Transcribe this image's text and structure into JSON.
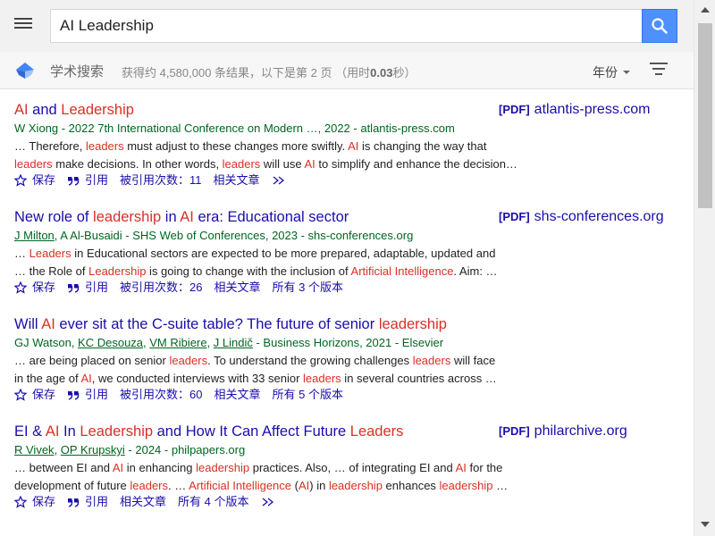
{
  "search": {
    "query": "AI Leadership",
    "button_icon": "search-icon",
    "button_color": "#4d90fe"
  },
  "header": {
    "menu_icon": "hamburger-menu-icon",
    "brand": "学术搜索",
    "stats_prefix": "获得约 4,580,000 条结果，以下是第 2 页 （用时",
    "stats_time": "0.03",
    "stats_suffix": "秒）",
    "year_label": "年份",
    "filter_icon": "filter-icon"
  },
  "colors": {
    "link": "#1a0dab",
    "highlight": "#d93025",
    "meta": "#006621"
  },
  "actions_labels": {
    "save": "保存",
    "cite": "引用",
    "related": "相关文章"
  },
  "results": [
    {
      "title": [
        {
          "t": "AI",
          "h": true
        },
        {
          "t": " and ",
          "h": false
        },
        {
          "t": "Leadership",
          "h": true
        }
      ],
      "meta": [
        {
          "t": "W Xiong - 2022 7th International Conference on Modern …, 2022 - atlantis-press.com",
          "u": false
        }
      ],
      "snippet": [
        [
          {
            "t": "… Therefore, ",
            "h": false
          },
          {
            "t": "leaders",
            "h": true
          },
          {
            "t": " must adjust to these changes more swiftly. ",
            "h": false
          },
          {
            "t": "AI",
            "h": true
          },
          {
            "t": " is changing the way that",
            "h": false
          }
        ],
        [
          {
            "t": "leaders",
            "h": true
          },
          {
            "t": " make decisions. In other words, ",
            "h": false
          },
          {
            "t": "leaders",
            "h": true
          },
          {
            "t": " will use ",
            "h": false
          },
          {
            "t": "AI",
            "h": true
          },
          {
            "t": " to simplify and enhance the decision…",
            "h": false
          }
        ]
      ],
      "cited": "被引用次数：11",
      "versions": "",
      "more": true,
      "pdf_tag": "[PDF]",
      "pdf_site": "atlantis-press.com"
    },
    {
      "title": [
        {
          "t": "New role of ",
          "h": false
        },
        {
          "t": "leadership",
          "h": true
        },
        {
          "t": " in ",
          "h": false
        },
        {
          "t": "AI",
          "h": true
        },
        {
          "t": " era: Educational sector",
          "h": false
        }
      ],
      "meta": [
        {
          "t": "J Milton",
          "u": true
        },
        {
          "t": ", A Al-Busaidi - SHS Web of Conferences, 2023 - shs-conferences.org",
          "u": false
        }
      ],
      "snippet": [
        [
          {
            "t": "… ",
            "h": false
          },
          {
            "t": "Leaders",
            "h": true
          },
          {
            "t": " in Educational sectors are expected to be more prepared, adaptable, updated and",
            "h": false
          }
        ],
        [
          {
            "t": "… the Role of ",
            "h": false
          },
          {
            "t": "Leadership",
            "h": true
          },
          {
            "t": " is going to change with the inclusion of ",
            "h": false
          },
          {
            "t": "Artificial Intelligence",
            "h": true
          },
          {
            "t": ". Aim: …",
            "h": false
          }
        ]
      ],
      "cited": "被引用次数：26",
      "versions": "所有 3 个版本",
      "more": false,
      "pdf_tag": "[PDF]",
      "pdf_site": "shs-conferences.org"
    },
    {
      "title": [
        {
          "t": "Will ",
          "h": false
        },
        {
          "t": "AI",
          "h": true
        },
        {
          "t": " ever sit at the C-suite table? The future of senior ",
          "h": false
        },
        {
          "t": "leadership",
          "h": true
        }
      ],
      "meta": [
        {
          "t": "GJ Watson, ",
          "u": false
        },
        {
          "t": "KC Desouza",
          "u": true
        },
        {
          "t": ", ",
          "u": false
        },
        {
          "t": "VM Ribiere",
          "u": true
        },
        {
          "t": ", ",
          "u": false
        },
        {
          "t": "J Lindič",
          "u": true
        },
        {
          "t": " - Business Horizons, 2021 - Elsevier",
          "u": false
        }
      ],
      "snippet": [
        [
          {
            "t": "… are being placed on senior ",
            "h": false
          },
          {
            "t": "leaders",
            "h": true
          },
          {
            "t": ". To understand the growing challenges ",
            "h": false
          },
          {
            "t": "leaders",
            "h": true
          },
          {
            "t": " will face",
            "h": false
          }
        ],
        [
          {
            "t": "in the age of ",
            "h": false
          },
          {
            "t": "AI",
            "h": true
          },
          {
            "t": ", we conducted interviews with 33 senior ",
            "h": false
          },
          {
            "t": "leaders",
            "h": true
          },
          {
            "t": " in several countries across …",
            "h": false
          }
        ]
      ],
      "cited": "被引用次数：60",
      "versions": "所有 5 个版本",
      "more": false,
      "pdf_tag": "",
      "pdf_site": ""
    },
    {
      "title": [
        {
          "t": "EI & ",
          "h": false
        },
        {
          "t": "AI",
          "h": true
        },
        {
          "t": " In ",
          "h": false
        },
        {
          "t": "Leadership",
          "h": true
        },
        {
          "t": " and How It Can Affect Future ",
          "h": false
        },
        {
          "t": "Leaders",
          "h": true
        }
      ],
      "meta": [
        {
          "t": "R Vivek",
          "u": true
        },
        {
          "t": ", ",
          "u": false
        },
        {
          "t": "OP Krupskyi",
          "u": true
        },
        {
          "t": " - 2024 - philpapers.org",
          "u": false
        }
      ],
      "snippet": [
        [
          {
            "t": "… between EI and ",
            "h": false
          },
          {
            "t": "AI",
            "h": true
          },
          {
            "t": " in enhancing ",
            "h": false
          },
          {
            "t": "leadership",
            "h": true
          },
          {
            "t": " practices. Also, … of integrating EI and ",
            "h": false
          },
          {
            "t": "AI",
            "h": true
          },
          {
            "t": " for the",
            "h": false
          }
        ],
        [
          {
            "t": "development of future ",
            "h": false
          },
          {
            "t": "leaders",
            "h": true
          },
          {
            "t": ". … ",
            "h": false
          },
          {
            "t": "Artificial Intelligence",
            "h": true
          },
          {
            "t": " (",
            "h": false
          },
          {
            "t": "AI",
            "h": true
          },
          {
            "t": ") in ",
            "h": false
          },
          {
            "t": "leadership",
            "h": true
          },
          {
            "t": " enhances ",
            "h": false
          },
          {
            "t": "leadership",
            "h": true
          },
          {
            "t": " …",
            "h": false
          }
        ]
      ],
      "cited": "",
      "versions": "所有 4 个版本",
      "more": true,
      "pdf_tag": "[PDF]",
      "pdf_site": "philarchive.org"
    }
  ]
}
